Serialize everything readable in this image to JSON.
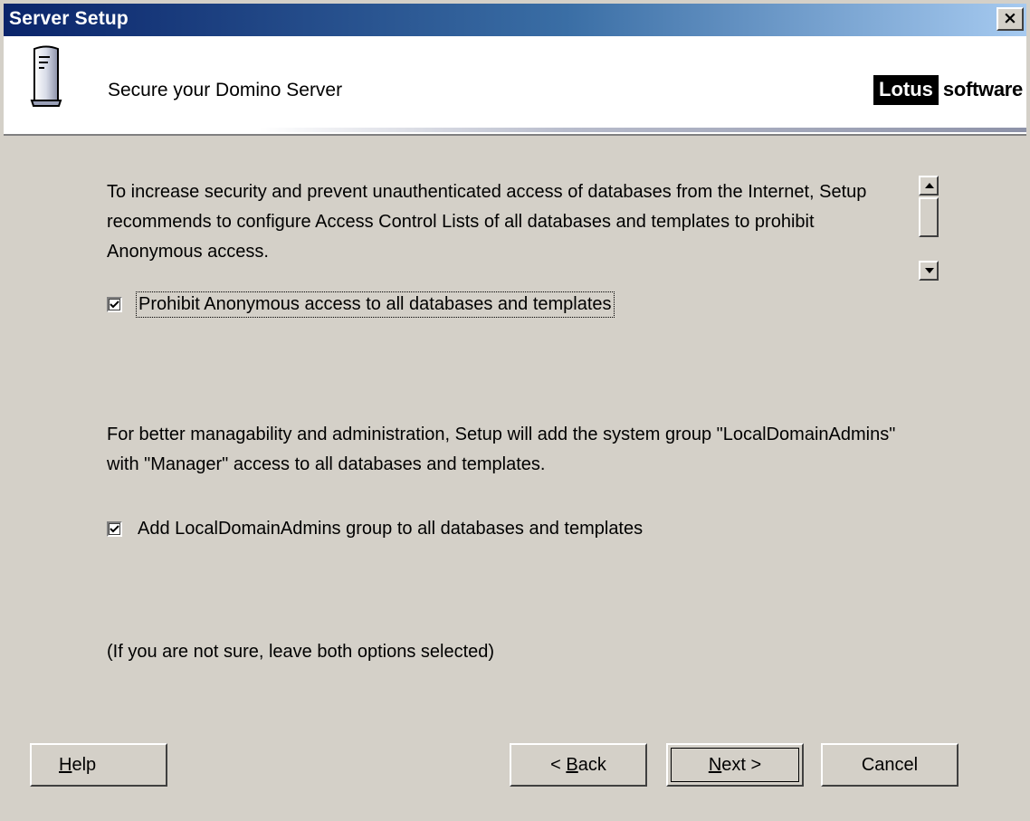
{
  "window": {
    "title": "Server Setup",
    "close_label": "×"
  },
  "header": {
    "title": "Secure your Domino Server",
    "logo_lotus": "Lotus",
    "logo_software": "software",
    "icon": "server-icon"
  },
  "content": {
    "paragraph1": "To increase security and prevent unauthenticated access of databases from the Internet, Setup recommends to configure Access Control Lists of all databases and templates to prohibit Anonymous access.",
    "checkbox1": {
      "label": "Prohibit Anonymous access to all databases and templates",
      "checked": true
    },
    "paragraph2": "For better managability and administration, Setup will add the system group \"LocalDomainAdmins\" with \"Manager\" access to all databases and templates.",
    "checkbox2": {
      "label": "Add LocalDomainAdmins group to all databases and templates",
      "checked": true
    },
    "note": "(If you are not sure, leave both options selected)"
  },
  "buttons": {
    "help": {
      "mnemonic": "H",
      "rest": "elp"
    },
    "back": {
      "prefix": "< ",
      "mnemonic": "B",
      "rest": "ack"
    },
    "next": {
      "mnemonic": "N",
      "rest": "ext >"
    },
    "cancel": "Cancel"
  },
  "colors": {
    "title_bar_start": "#0a246a",
    "title_bar_end": "#a6caf0",
    "dialog_background": "#d4d0c8"
  }
}
